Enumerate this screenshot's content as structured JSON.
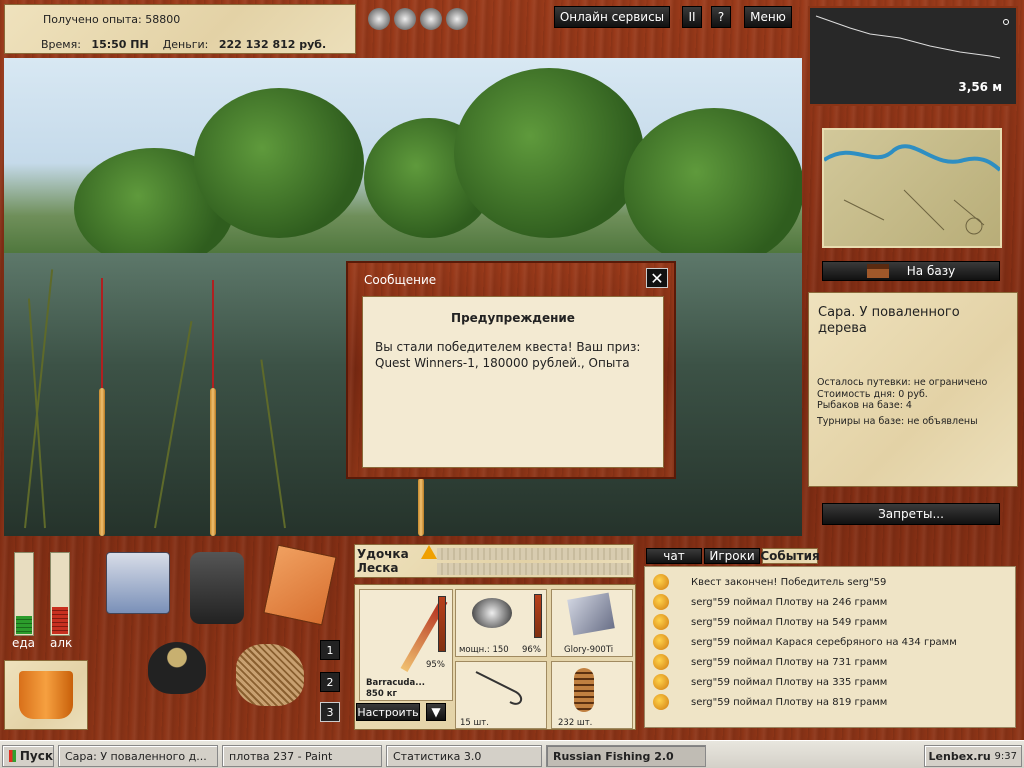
{
  "header": {
    "exp_label": "Получено опыта:",
    "exp_value": "58800",
    "time_label": "Время:",
    "time_value": "15:50 ПН",
    "money_label": "Деньги:",
    "money_value": "222 132 812 руб."
  },
  "topbar": {
    "online_label": "Онлайн сервисы",
    "pause_label": "II",
    "help_label": "?",
    "menu_label": "Меню"
  },
  "dialog": {
    "title": "Сообщение",
    "close_label": "✕",
    "heading": "Предупреждение",
    "text": "Вы стали победителем квеста! Ваш приз: Quest Winners-1, 180000 рублей., Опыта"
  },
  "depth": {
    "value": "3,56 м"
  },
  "place": {
    "base_button": "На базу",
    "name": "Сара. У поваленного дерева",
    "trip_left": "Осталось путевки: не ограничено",
    "day_cost": "Стоимость дня: 0 руб.",
    "fishermen": "Рыбаков на базе: 4",
    "tournaments": "Турниры на базе: не объявлены",
    "bans_button": "Запреты..."
  },
  "meters": {
    "food_label": "еда",
    "alc_label": "алк",
    "food_level": 0.22,
    "alc_level": 0.33
  },
  "rod_numbers": [
    "1",
    "2",
    "3"
  ],
  "tackle": {
    "rod_label": "Удочка",
    "line_label": "Леска",
    "rod_name": "Barracuda...",
    "rod_weight": "850 кг",
    "rod_pct": "95%",
    "reel_power": "мощн.: 150",
    "reel_pct": "96%",
    "line_name": "Glory-900Ti",
    "hooks_count": "15 шт.",
    "bait_count": "232 шт.",
    "setup_button": "Настроить"
  },
  "events": {
    "tabs": [
      "чат",
      "Игроки",
      "События"
    ],
    "items": [
      "Квест закончен! Победитель serg\"59",
      "serg\"59 поймал Плотву на 246 грамм",
      "serg\"59 поймал Плотву на 549 грамм",
      "serg\"59 поймал Карася серебряного на 434 грамм",
      "serg\"59 поймал Плотву на 731 грамм",
      "serg\"59 поймал Плотву на 335 грамм",
      "serg\"59 поймал Плотву на 819 грамм"
    ]
  },
  "taskbar": {
    "start": "Пуск",
    "tasks": [
      "Сара: У поваленного д...",
      "плотва 237 - Paint",
      "Статистика 3.0",
      "Russian Fishing 2.0"
    ],
    "clock": "9:37",
    "watermark": "Lenbex.ru"
  },
  "colors": {
    "wood": "#8e3517",
    "dark_button": "#111111",
    "parchment": "#efe2bd"
  }
}
